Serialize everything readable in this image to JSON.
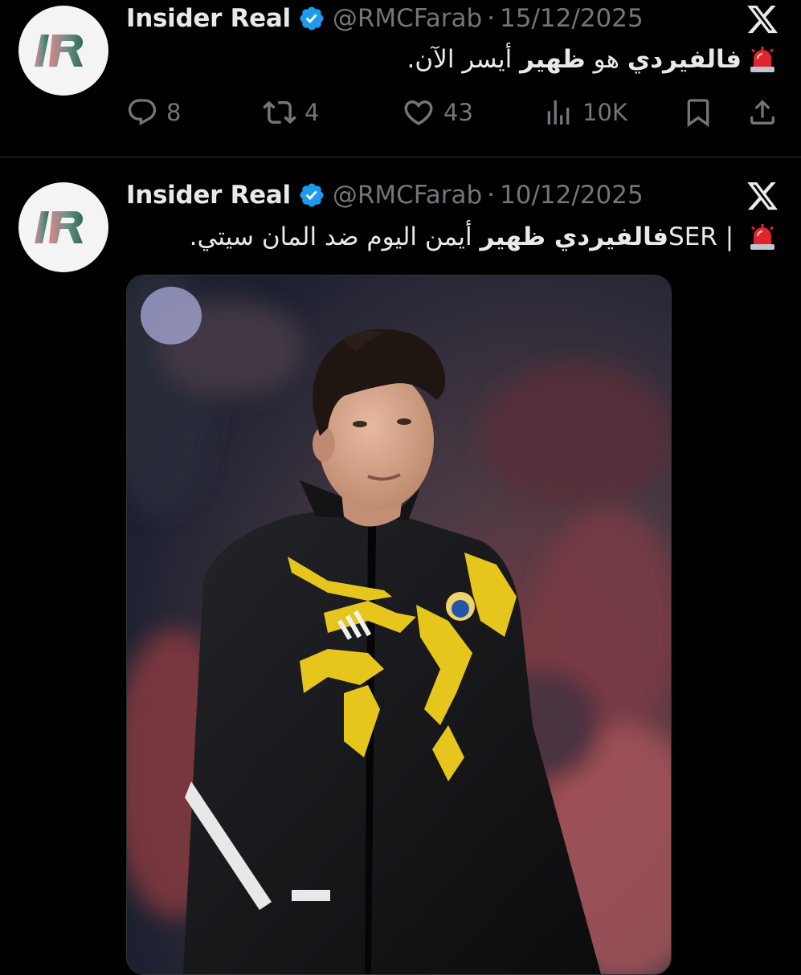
{
  "tweets": [
    {
      "author_name": "Insider Real",
      "handle": "@RMCFarab",
      "separator": "·",
      "date": "15/12/2025",
      "text_bold": "فالفيردي",
      "text_mid": " هو ",
      "text_bold2": "ظهير",
      "text_rest": " أيسر الآن.",
      "replies": "8",
      "reposts": "4",
      "likes": "43",
      "views": "10K"
    },
    {
      "author_name": "Insider Real",
      "handle": "@RMCFarab",
      "separator": "·",
      "date": "10/12/2025",
      "text_prefix": "SER | ",
      "text_bold": "فالفيردي ظهير",
      "text_rest": " أيمن اليوم ضد المان سيتي.",
      "media_icon": "photo"
    }
  ],
  "icons": {
    "avatar": "insider-real-logo",
    "verified": "verified-badge",
    "platform": "x-logo",
    "emoji": "police-siren",
    "reply": "reply-icon",
    "repost": "repost-icon",
    "like": "heart-icon",
    "views": "views-icon",
    "bookmark": "bookmark-icon",
    "share": "share-icon"
  },
  "colors": {
    "background": "#000000",
    "text": "#e7e9ea",
    "muted": "#71767b",
    "verified": "#1d9bf0",
    "divider": "#2f3336"
  }
}
